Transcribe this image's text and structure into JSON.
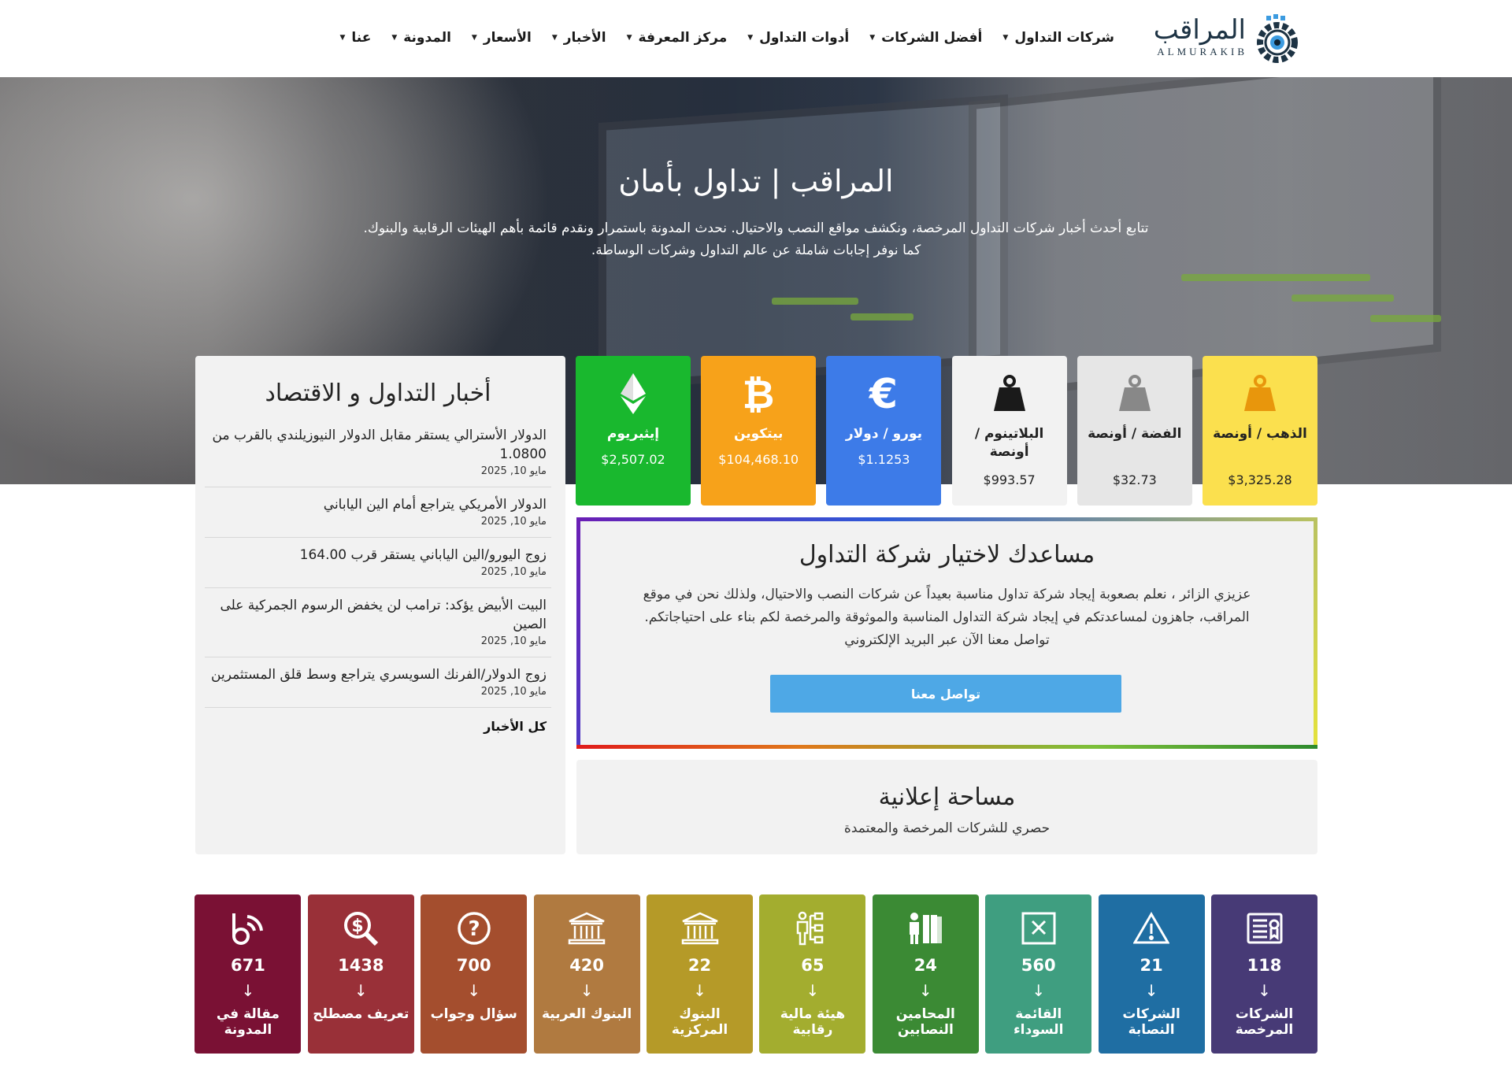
{
  "brand": {
    "name_ar": "المراقب",
    "name_lat": "ALMURAKIB"
  },
  "nav": [
    {
      "label": "شركات التداول"
    },
    {
      "label": "أفضل الشركات"
    },
    {
      "label": "أدوات التداول"
    },
    {
      "label": "مركز المعرفة"
    },
    {
      "label": "الأخبار"
    },
    {
      "label": "الأسعار"
    },
    {
      "label": "المدونة"
    },
    {
      "label": "عنا"
    }
  ],
  "hero": {
    "title": "المراقب | تداول بأمان",
    "desc_line1": "تتابع أحدث أخبار شركات التداول المرخصة، ونكشف مواقع النصب والاحتيال. نحدث المدونة باستمرار ونقدم قائمة بأهم الهيئات الرقابية والبنوك.",
    "desc_line2": "كما نوفر إجابات شاملة عن عالم التداول وشركات الوساطة."
  },
  "news": {
    "title": "أخبار التداول و الاقتصاد",
    "items": [
      {
        "title": "الدولار الأسترالي يستقر مقابل الدولار النيوزيلندي بالقرب من 1.0800",
        "date": "مايو 10, 2025"
      },
      {
        "title": "الدولار الأمريكي يتراجع أمام الين الياباني",
        "date": "مايو 10, 2025"
      },
      {
        "title": "زوج اليورو/الين الياباني يستقر قرب 164.00",
        "date": "مايو 10, 2025"
      },
      {
        "title": "البيت الأبيض يؤكد: ترامب لن يخفض الرسوم الجمركية على الصين",
        "date": "مايو 10, 2025"
      },
      {
        "title": "زوج الدولار/الفرنك السويسري يتراجع وسط قلق المستثمرين",
        "date": "مايو 10, 2025"
      }
    ],
    "all_label": "كل الأخبار"
  },
  "prices": [
    {
      "name": "الذهب / أونصة",
      "value": "$3,325.28",
      "bg": "#fbe04e",
      "fg": "#222",
      "icon": "weight-icon",
      "icon_color": "#e8960c"
    },
    {
      "name": "الفضة / أونصة",
      "value": "$32.73",
      "bg": "#e6e6e6",
      "fg": "#222",
      "icon": "weight-icon",
      "icon_color": "#888888"
    },
    {
      "name": "البلاتينوم / أونصة",
      "value": "$993.57",
      "bg": "#f2f2f2",
      "fg": "#222",
      "icon": "weight-icon",
      "icon_color": "#1a1a1a"
    },
    {
      "name": "يورو / دولار",
      "value": "$1.1253",
      "bg": "#3d7be8",
      "fg": "#fff",
      "icon": "euro-icon",
      "icon_color": "#ffffff"
    },
    {
      "name": "بيتكوين",
      "value": "$104,468.10",
      "bg": "#f7a21a",
      "fg": "#fff",
      "icon": "bitcoin-icon",
      "icon_color": "#ffffff"
    },
    {
      "name": "إيثيريوم",
      "value": "$2,507.02",
      "bg": "#19b82e",
      "fg": "#fff",
      "icon": "ethereum-icon",
      "icon_color": "#ffffff"
    }
  ],
  "helper": {
    "title": "مساعدك لاختيار شركة التداول",
    "line1": "عزيزي الزائر ، نعلم بصعوبة إيجاد شركة تداول مناسبة بعيداً عن شركات النصب والاحتيال، ولذلك نحن في موقع",
    "line2": "المراقب، جاهزون لمساعدتكم في إيجاد شركة التداول المناسبة والموثوقة والمرخصة لكم بناء على احتياجاتكم.",
    "line3": "تواصل معنا الآن عبر البريد الإلكتروني",
    "button": "تواصل معنا"
  },
  "ad": {
    "title": "مساحة إعلانية",
    "subtitle": "حصري للشركات المرخصة والمعتمدة"
  },
  "stats": [
    {
      "count": "118",
      "label": "الشركات المرخصة",
      "bg": "#473a76",
      "icon": "license-icon"
    },
    {
      "count": "21",
      "label": "الشركات النصابة",
      "bg": "#1f6ea3",
      "icon": "warning-icon"
    },
    {
      "count": "560",
      "label": "القائمة السوداء",
      "bg": "#3f9e80",
      "icon": "blacklist-icon"
    },
    {
      "count": "24",
      "label": "المحامين النصابين",
      "bg": "#3b8a34",
      "icon": "lawyer-icon"
    },
    {
      "count": "65",
      "label": "هيئة مالية رقابية",
      "bg": "#a3ad2f",
      "icon": "regulator-icon"
    },
    {
      "count": "22",
      "label": "البنوك المركزية",
      "bg": "#b59a28",
      "icon": "bank-icon"
    },
    {
      "count": "420",
      "label": "البنوك العربية",
      "bg": "#b07a40",
      "icon": "bank-icon"
    },
    {
      "count": "700",
      "label": "سؤال وجواب",
      "bg": "#a44e2e",
      "icon": "question-icon"
    },
    {
      "count": "1438",
      "label": "تعريف مصطلح",
      "bg": "#993038",
      "icon": "search-dollar-icon"
    },
    {
      "count": "671",
      "label": "مقالة في المدونة",
      "bg": "#7a1134",
      "icon": "blog-icon"
    }
  ],
  "arrow_glyph": "↓"
}
